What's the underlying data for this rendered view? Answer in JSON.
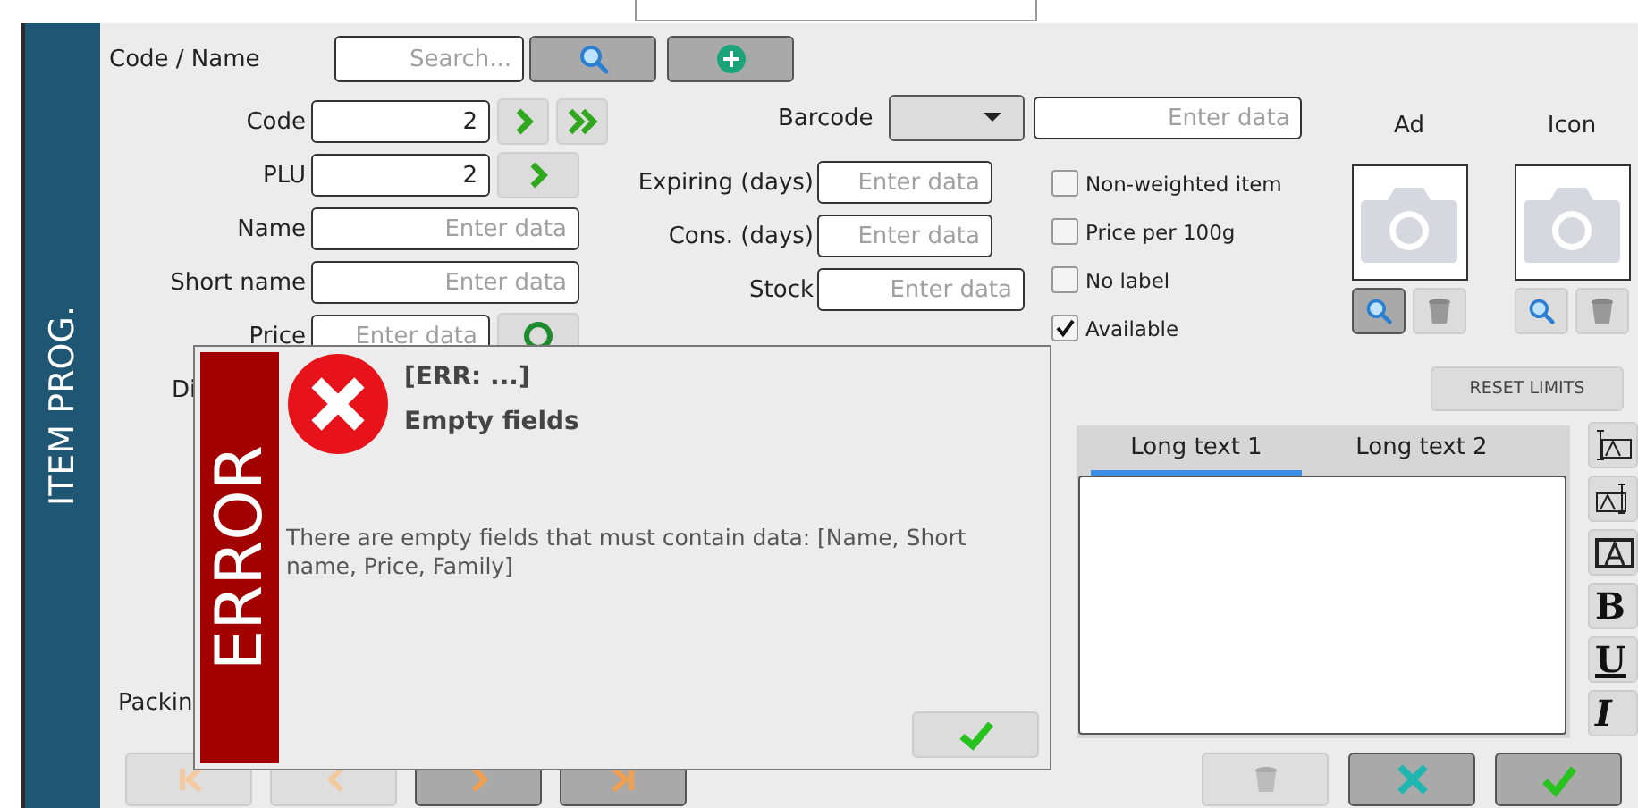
{
  "sidebar": {
    "title": "ITEM PROG."
  },
  "search": {
    "label": "Code / Name",
    "placeholder": "Search..."
  },
  "fields_left": [
    {
      "label": "Code",
      "value": "2",
      "actions": [
        {
          "kind": "next"
        },
        {
          "kind": "last"
        }
      ]
    },
    {
      "label": "PLU",
      "value": "2",
      "actions": [
        {
          "kind": "next"
        }
      ]
    },
    {
      "label": "Name",
      "placeholder": "Enter data"
    },
    {
      "label": "Short name",
      "placeholder": "Enter data"
    },
    {
      "label": "Price",
      "placeholder": "Enter data",
      "actions": [
        {
          "kind": "toggle"
        }
      ]
    }
  ],
  "cut_labels": [
    {
      "label": "Di"
    },
    {
      "label": "Packin"
    }
  ],
  "barcode": {
    "label": "Barcode",
    "placeholder": "Enter data"
  },
  "fields_right": [
    {
      "label": "Expiring (days)",
      "placeholder": "Enter data",
      "wide": false
    },
    {
      "label": "Cons. (days)",
      "placeholder": "Enter data",
      "wide": false
    },
    {
      "label": "Stock",
      "placeholder": "Enter data",
      "wide": true
    }
  ],
  "options": [
    {
      "label": "Non-weighted item",
      "checked": false
    },
    {
      "label": "Price per 100g",
      "checked": false
    },
    {
      "label": "No label",
      "checked": false
    },
    {
      "label": "Available",
      "checked": true
    }
  ],
  "images": [
    {
      "label": "Ad",
      "selected": true
    },
    {
      "label": "Icon",
      "selected": false
    }
  ],
  "reset_button": "RESET LIMITS",
  "editor": {
    "tabs": [
      {
        "label": "Long text 1",
        "selected": true
      },
      {
        "label": "Long text 2",
        "selected": false
      }
    ]
  },
  "format_tools": [
    {
      "kind": "above"
    },
    {
      "kind": "below"
    },
    {
      "kind": "box"
    },
    {
      "kind": "bold",
      "label": "B"
    },
    {
      "kind": "underline",
      "label": "U"
    },
    {
      "kind": "italic",
      "label": "I"
    }
  ],
  "navigation": [
    {
      "kind": "first",
      "disabled": true
    },
    {
      "kind": "prev",
      "disabled": true
    },
    {
      "kind": "next",
      "disabled": false
    },
    {
      "kind": "last",
      "disabled": false
    }
  ],
  "actions": [
    {
      "kind": "delete",
      "disabled": true
    },
    {
      "kind": "cancel",
      "disabled": false
    },
    {
      "kind": "confirm",
      "disabled": false
    }
  ],
  "dialog": {
    "banner": "ERROR",
    "code": "[ERR: ...]",
    "title": "Empty fields",
    "message": "There are empty fields that must contain data: [Name, Short name, Price, Family]"
  }
}
